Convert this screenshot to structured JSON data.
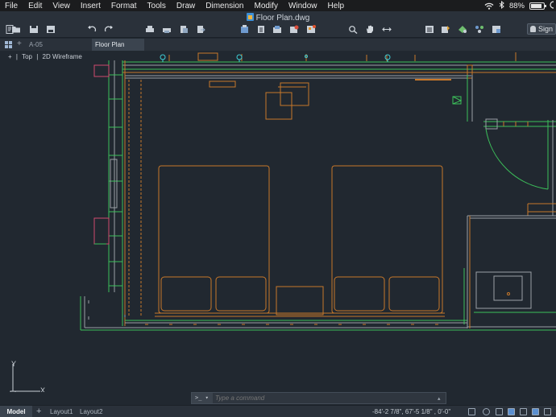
{
  "menubar": {
    "apple": "",
    "items": [
      "File",
      "Edit",
      "View",
      "Insert",
      "Format",
      "Tools",
      "Draw",
      "Dimension",
      "Modify",
      "Window",
      "Help"
    ],
    "battery_percent": "88%",
    "battery_level": 0.88
  },
  "window": {
    "title": "Floor Plan.dwg",
    "sign_in": "Sign"
  },
  "tabs": {
    "sheet_label": "A-05",
    "active_tab": "Floor Plan"
  },
  "viewport": {
    "view_name": "Top",
    "visual_style": "2D Wireframe",
    "toggle": "+"
  },
  "ucs": {
    "y": "Y",
    "x": "X"
  },
  "command": {
    "prompt": ">_",
    "placeholder": "Type a command"
  },
  "status": {
    "model_tab": "Model",
    "layouts": [
      "Layout1",
      "Layout2"
    ],
    "coordinates": "-84'-2 7/8\",  67'-5 1/8\" , 0'-0\""
  },
  "colors": {
    "orange": "#c8782a",
    "green": "#3cbf5a",
    "grey": "#9aa0a6",
    "cyan": "#3ecfd6",
    "magenta": "#d04a6e"
  }
}
